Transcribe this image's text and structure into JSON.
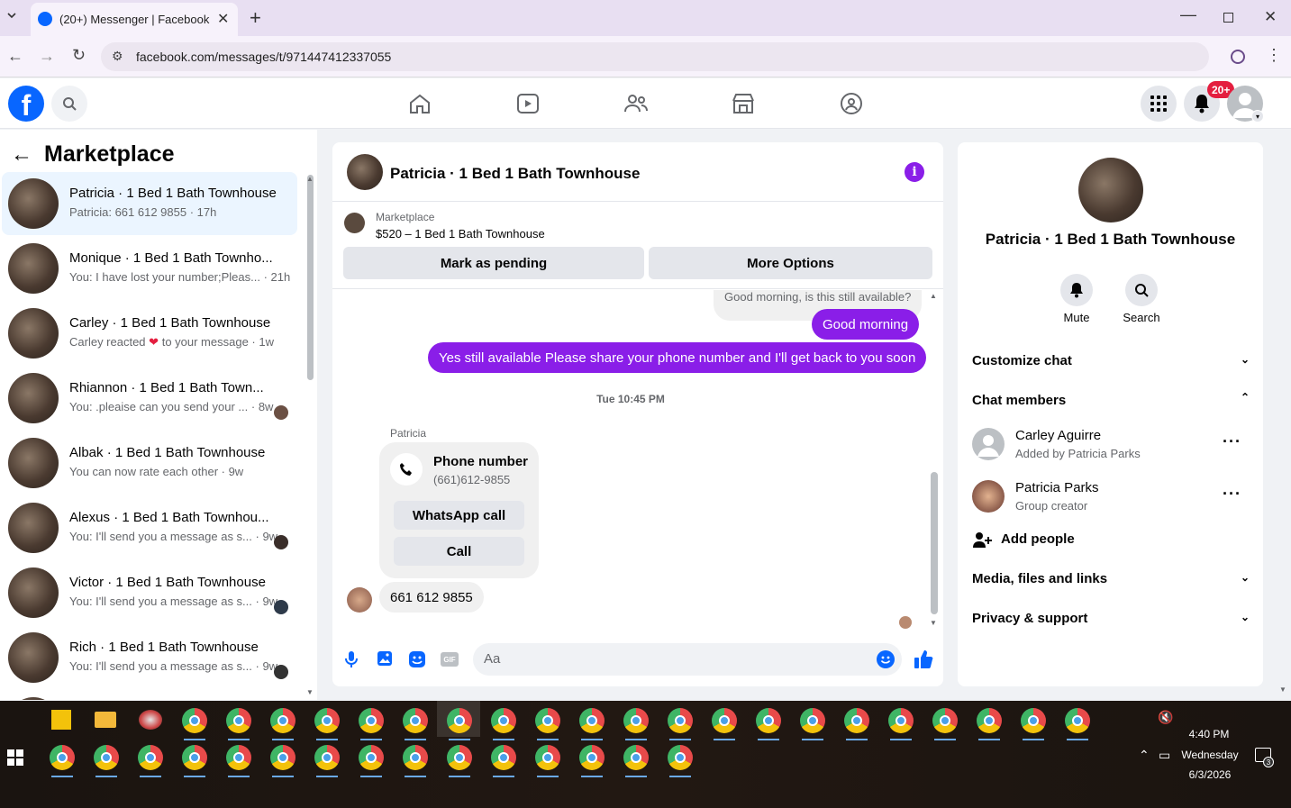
{
  "browser": {
    "tab_title": "(20+) Messenger | Facebook",
    "url": "facebook.com/messages/t/971447412337055"
  },
  "header": {
    "notifications_badge": "20+"
  },
  "sidebar": {
    "title": "Marketplace",
    "conversations": [
      {
        "name": "Patricia · 1 Bed 1 Bath Townhouse",
        "preview": "Patricia: 661 612 9855 · 17h",
        "active": true
      },
      {
        "name": "Monique · 1 Bed 1 Bath Townho...",
        "preview": "You: I have lost your number;Pleas... · 21h"
      },
      {
        "name": "Carley · 1 Bed 1 Bath Townhouse",
        "preview_pre": "Carley reacted",
        "preview_post": "to your message · 1w"
      },
      {
        "name": "Rhiannon · 1 Bed 1 Bath Town...",
        "preview": "You: .pleaise can you send your ... · 8w"
      },
      {
        "name": "Albak · 1 Bed 1 Bath Townhouse",
        "preview": "You can now rate each other · 9w"
      },
      {
        "name": "Alexus · 1 Bed 1 Bath Townhou...",
        "preview": "You: I'll send you a message as s... · 9w"
      },
      {
        "name": "Victor · 1 Bed 1 Bath Townhouse",
        "preview": "You: I'll send you a message as s... · 9w"
      },
      {
        "name": "Rich · 1 Bed 1 Bath Townhouse",
        "preview": "You: I'll send you a message as s... · 9w"
      }
    ]
  },
  "chat": {
    "title": "Patricia · 1 Bed 1 Bath Townhouse",
    "listing_source": "Marketplace",
    "listing": "$520 – 1 Bed 1 Bath Townhouse",
    "mark_pending": "Mark as pending",
    "more_options": "More Options",
    "messages": {
      "m1": "Good morning, is this still available?",
      "m2": "Good morning",
      "m3": "Yes still available Please share your phone number and I'll get back to you soon",
      "timestamp": "Tue 10:45 PM",
      "sender": "Patricia",
      "phone_title": "Phone number",
      "phone_number": "(661)612-9855",
      "whatsapp": "WhatsApp call",
      "call": "Call",
      "m4": "661 612 9855"
    },
    "composer_placeholder": "Aa"
  },
  "details": {
    "name": "Patricia · 1 Bed 1 Bath Townhouse",
    "mute": "Mute",
    "search": "Search",
    "customize": "Customize chat",
    "chat_members": "Chat members",
    "members": [
      {
        "name": "Carley Aguirre",
        "role": "Added by Patricia Parks"
      },
      {
        "name": "Patricia Parks",
        "role": "Group creator"
      }
    ],
    "add_people": "Add people",
    "media": "Media, files and links",
    "privacy": "Privacy & support"
  },
  "taskbar": {
    "time": "4:40 PM",
    "day": "Wednesday",
    "date": "6/3/2026",
    "notif_count": "3"
  },
  "colors": {
    "accent": "#8a1ee8",
    "fb_blue": "#0866ff",
    "badge_red": "#e41e3f"
  }
}
